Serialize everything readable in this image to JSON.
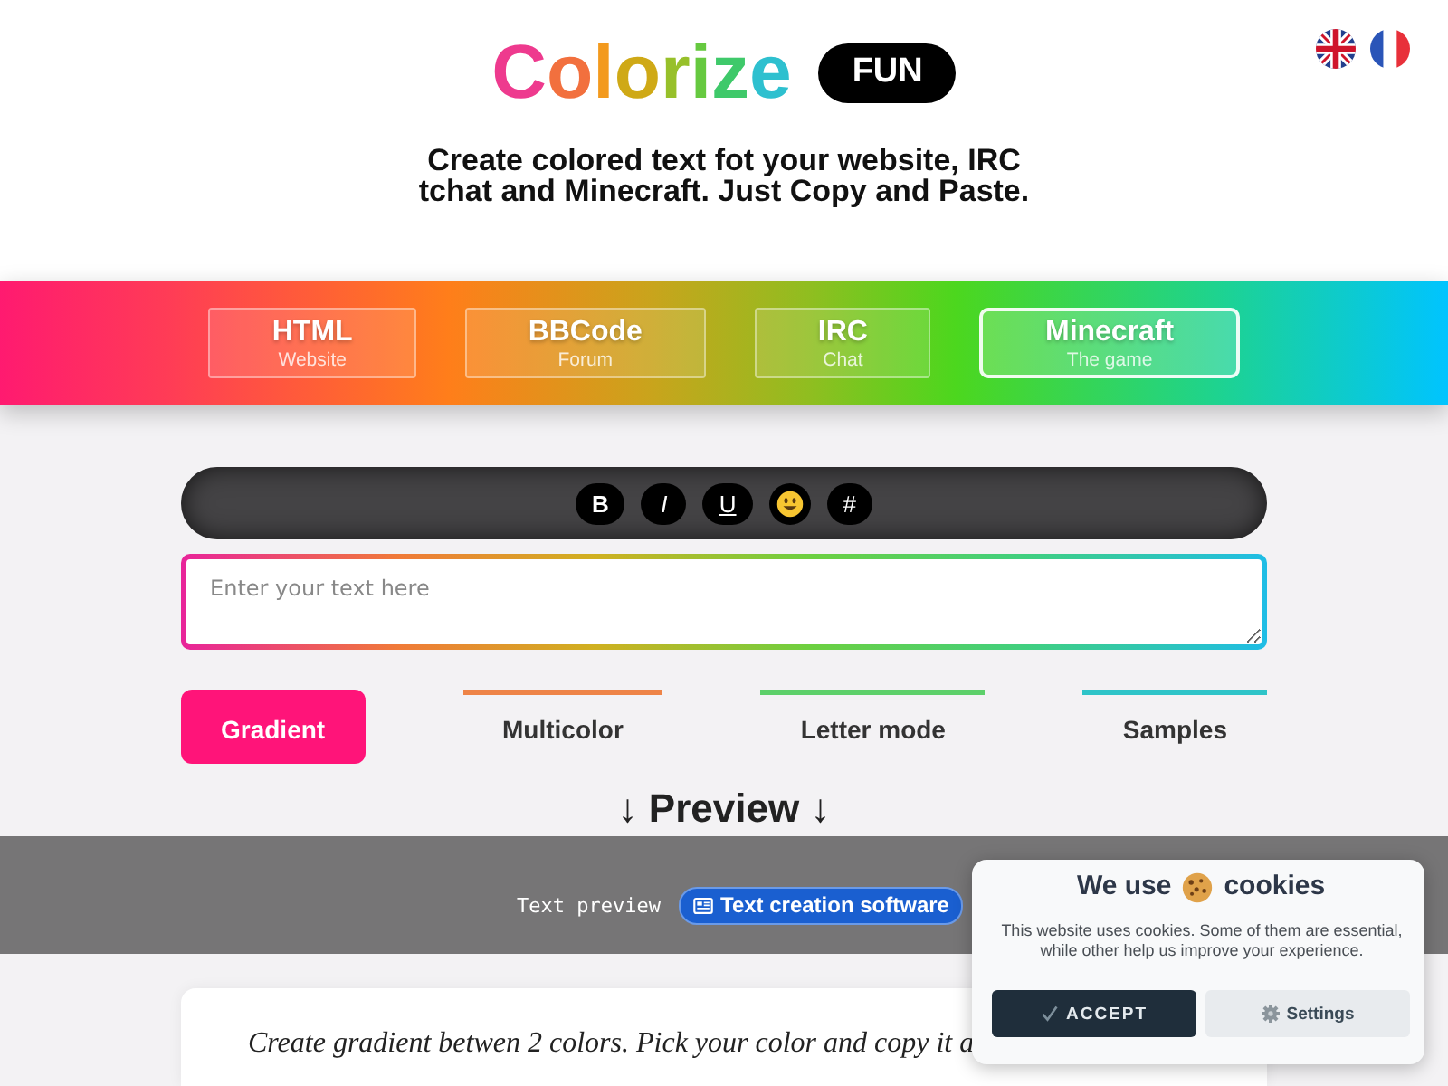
{
  "header": {
    "logo": "Colorize",
    "badge": "FUN",
    "tagline": "Create colored text fot your website, IRC tchat and Minecraft. Just Copy and Paste."
  },
  "formats": [
    {
      "title": "HTML",
      "subtitle": "Website",
      "selected": false
    },
    {
      "title": "BBCode",
      "subtitle": "Forum",
      "selected": false
    },
    {
      "title": "IRC",
      "subtitle": "Chat",
      "selected": false
    },
    {
      "title": "Minecraft",
      "subtitle": "The game",
      "selected": true
    }
  ],
  "toolbar": [
    {
      "kind": "bold",
      "label": "B"
    },
    {
      "kind": "italic",
      "label": "I"
    },
    {
      "kind": "underline",
      "label": "U"
    },
    {
      "kind": "emoji"
    },
    {
      "kind": "hash",
      "label": "#"
    }
  ],
  "editor": {
    "placeholder": "Enter your text here"
  },
  "modes": [
    {
      "label": "Gradient",
      "selected": true,
      "color": "#ff1479"
    },
    {
      "label": "Multicolor",
      "selected": false,
      "color": "#ee8447"
    },
    {
      "label": "Letter mode",
      "selected": false,
      "color": "#5dd06a"
    },
    {
      "label": "Samples",
      "selected": false,
      "color": "#2ec4c8"
    }
  ],
  "preview": {
    "heading": "↓ **Preview** ↓",
    "label": "Text preview",
    "badge": "Text creation software",
    "text": "Create gradient betwen 2 colors. Pick your color and copy it a"
  },
  "cookie_banner": {
    "title_start": "We use",
    "title_end": "cookies",
    "message": "This website uses cookies. Some of them are essential, while other help us improve your experience.",
    "buttons": [
      {
        "kind": "accept",
        "label": "ACCEPT"
      },
      {
        "kind": "settings",
        "label": "Settings"
      }
    ]
  }
}
